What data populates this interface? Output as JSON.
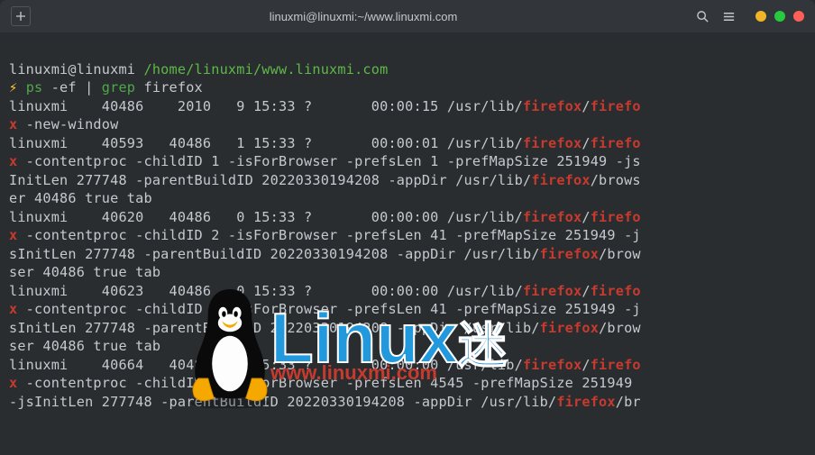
{
  "titlebar": {
    "title": "linuxmi@linuxmi:~/www.linuxmi.com"
  },
  "prompt": {
    "user": "linuxmi@linuxmi",
    "path": "/home/linuxmi/www.linuxmi.com",
    "command": "ps -ef | grep firefox"
  },
  "rows": [
    {
      "cols": "linuxmi    40486    2010   9 15:33 ?       00:00:15 /usr/lib/",
      "match1": "firefox",
      "mid1": "/",
      "match2": "firefo",
      "wrap": " -new-window"
    },
    {
      "cols": "linuxmi    40593   40486   1 15:33 ?       00:00:01 /usr/lib/",
      "match1": "firefox",
      "mid1": "/",
      "match2": "firefo",
      "wrap": " -contentproc -childID 1 -isForBrowser -prefsLen 1 -prefMapSize 251949 -js",
      "wrap2a": "InitLen 277748 -parentBuildID 20220330194208 -appDir /usr/lib/",
      "wrap2match": "firefox",
      "wrap2b": "/brows",
      "wrap3": "er 40486 true tab"
    },
    {
      "cols": "linuxmi    40620   40486   0 15:33 ?       00:00:00 /usr/lib/",
      "match1": "firefox",
      "mid1": "/",
      "match2": "firefo",
      "wrap": " -contentproc -childID 2 -isForBrowser -prefsLen 41 -prefMapSize 251949 -j",
      "wrap2a": "sInitLen 277748 -parentBuildID 20220330194208 -appDir /usr/lib/",
      "wrap2match": "firefox",
      "wrap2b": "/brow",
      "wrap3": "ser 40486 true tab"
    },
    {
      "cols": "linuxmi    40623   40486   0 15:33 ?       00:00:00 /usr/lib/",
      "match1": "firefox",
      "mid1": "/",
      "match2": "firefo",
      "wrap": " -contentproc -childID 3 -isForBrowser -prefsLen 41 -prefMapSize 251949 -j",
      "wrap2a": "sInitLen 277748 -parentBuildID 20220330194208 -appDir /usr/lib/",
      "wrap2match": "firefox",
      "wrap2b": "/brow",
      "wrap3": "ser 40486 true tab"
    },
    {
      "cols": "linuxmi    40664   40486   0 15:33 ?       00:00:00 /usr/lib/",
      "match1": "firefox",
      "mid1": "/",
      "match2": "firefo",
      "wrap": " -contentproc -childID 4 -isForBrowser -prefsLen 4545 -prefMapSize 251949 ",
      "wrap2a": "-jsInitLen 277748 -parentBuildID 20220330194208 -appDir /usr/lib/",
      "wrap2match": "firefox",
      "wrap2b": "/br"
    }
  ],
  "watermark": {
    "text_main": "Linux",
    "text_sub": "迷",
    "url": "www.linuxmi.com"
  }
}
